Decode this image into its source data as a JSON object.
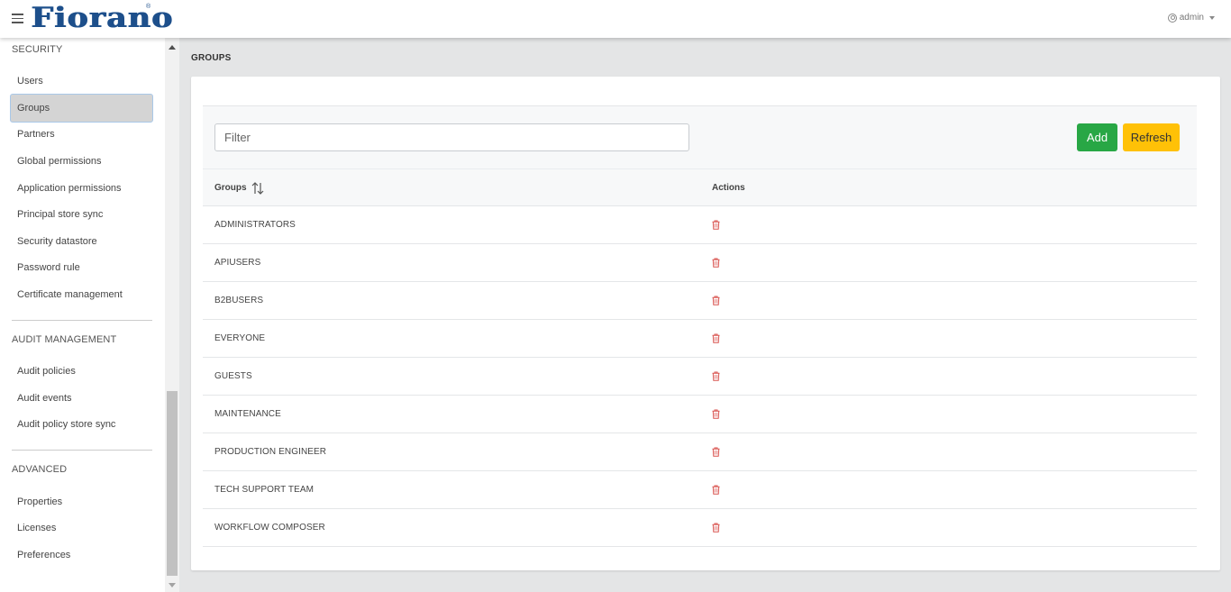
{
  "header": {
    "logo_text": "Fiorano",
    "logo_mark": "®",
    "user_label": "admin"
  },
  "sidebar": {
    "sections": [
      {
        "title": "SECURITY",
        "items": [
          "Users",
          "Groups",
          "Partners",
          "Global permissions",
          "Application permissions",
          "Principal store sync",
          "Security datastore",
          "Password rule",
          "Certificate management"
        ]
      },
      {
        "title": "AUDIT MANAGEMENT",
        "items": [
          "Audit policies",
          "Audit events",
          "Audit policy store sync"
        ]
      },
      {
        "title": "ADVANCED",
        "items": [
          "Properties",
          "Licenses",
          "Preferences"
        ]
      }
    ],
    "active_item": "Groups"
  },
  "main": {
    "heading": "GROUPS",
    "filter_placeholder": "Filter",
    "add_label": "Add",
    "refresh_label": "Refresh",
    "columns": {
      "groups": "Groups",
      "actions": "Actions"
    },
    "groups": [
      "ADMINISTRATORS",
      "APIUSERS",
      "B2BUSERS",
      "EVERYONE",
      "GUESTS",
      "MAINTENANCE",
      "PRODUCTION ENGINEER",
      "TECH SUPPORT TEAM",
      "WORKFLOW COMPOSER"
    ]
  },
  "colors": {
    "brand": "#1d4f8b",
    "add_button": "#28a745",
    "refresh_button": "#ffc107",
    "delete_icon": "#d9534f"
  },
  "icons": {
    "menu": "hamburger-icon",
    "user": "user-circle-icon",
    "sort": "sort-arrows-icon",
    "delete": "trash-icon"
  }
}
